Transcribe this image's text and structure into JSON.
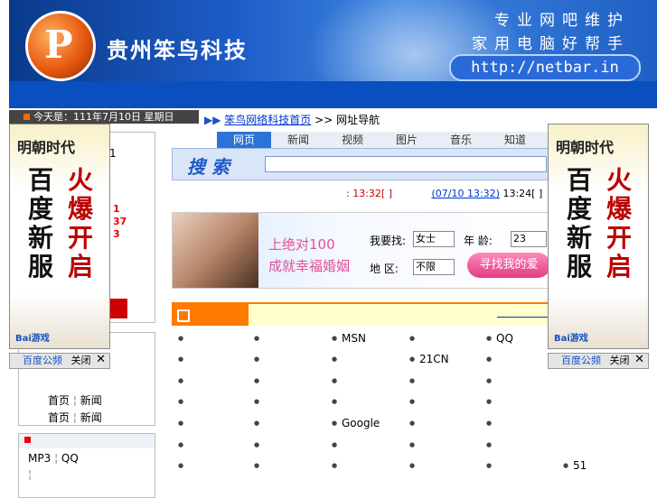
{
  "header": {
    "logo_glyph": "P",
    "brand": "贵州笨鸟科技",
    "slogan_line1": "专业网吧维护",
    "slogan_line2": "家用电脑好帮手",
    "url": "http://netbar.in"
  },
  "datebar": {
    "text": "今天是：111年7月10日 星期日"
  },
  "breadcrumb": {
    "home": "笨鸟网络科技首页",
    "sep": ">>",
    "current": "网址导航"
  },
  "search": {
    "tabs": [
      "网页",
      "新闻",
      "视频",
      "图片",
      "音乐",
      "知道"
    ],
    "label": "搜 索"
  },
  "ticker": {
    "item1": ": 13:32[ ]",
    "item2": "(07/10 13:32)",
    "item3": "13:24[ ]"
  },
  "ad": {
    "line1": "上绝对100",
    "line2": "成就幸福婚姻",
    "want_label": "我要找:",
    "gender": "女士",
    "age_label": "年   龄:",
    "age": "23",
    "region_label": "地   区:",
    "region": "不限",
    "find_button": "寻找我的爱"
  },
  "left_panel": {
    "top_lines": [
      "1",
      "",
      "",
      ""
    ],
    "red_numbers": [
      "1",
      "37",
      "3"
    ],
    "red_text": "",
    "pair_rows": [
      [
        "首页",
        "新闻"
      ],
      [
        "首页",
        "新闻"
      ]
    ],
    "mp3_row": [
      "MP3",
      "QQ"
    ],
    "bottom_rows": [
      [
        "",
        ""
      ],
      [
        "",
        ""
      ]
    ]
  },
  "grid": [
    [
      "",
      "",
      "MSN",
      "",
      "QQ",
      ""
    ],
    [
      "",
      "",
      "",
      "21CN",
      "",
      ""
    ],
    [
      "",
      "",
      "",
      "",
      "",
      ""
    ],
    [
      "",
      "",
      "",
      "",
      "",
      ""
    ],
    [
      "",
      "",
      "Google",
      "",
      "",
      ""
    ],
    [
      "",
      "",
      "",
      "",
      "",
      ""
    ],
    [
      "",
      "",
      "",
      "",
      "",
      "51"
    ],
    [
      "",
      "",
      "",
      "",
      "",
      ""
    ]
  ],
  "side_ads": {
    "title": "明朝时代",
    "col1": "百度新服",
    "col2": "火爆开启",
    "tag": "Bai游戏"
  },
  "close_bar": {
    "label": "百度公频",
    "close": "关闭",
    "x": "✕"
  },
  "colors": {
    "banner": "#1d5cc8",
    "accent": "#ff7a00",
    "link": "#0033cc"
  }
}
